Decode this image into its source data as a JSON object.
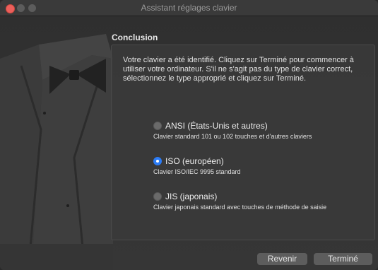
{
  "window": {
    "title": "Assistant réglages clavier"
  },
  "section": {
    "title": "Conclusion",
    "description": "Votre clavier a été identifié. Cliquez sur Terminé pour commencer à utiliser votre ordinateur. S'il ne s'agit pas du type de clavier correct, sélectionnez le type approprié et cliquez sur Terminé."
  },
  "options": [
    {
      "label": "ANSI (États-Unis et autres)",
      "sublabel": "Clavier standard 101 ou 102 touches et d'autres claviers",
      "selected": false
    },
    {
      "label": "ISO (européen)",
      "sublabel": "Clavier ISO/IEC 9995 standard",
      "selected": true
    },
    {
      "label": "JIS (japonais)",
      "sublabel": "Clavier japonais standard avec touches de méthode de saisie",
      "selected": false
    }
  ],
  "buttons": {
    "back": "Revenir",
    "done": "Terminé"
  },
  "colors": {
    "window_bg": "#323232",
    "accent": "#2c7cf6",
    "close": "#ec5f5b"
  }
}
